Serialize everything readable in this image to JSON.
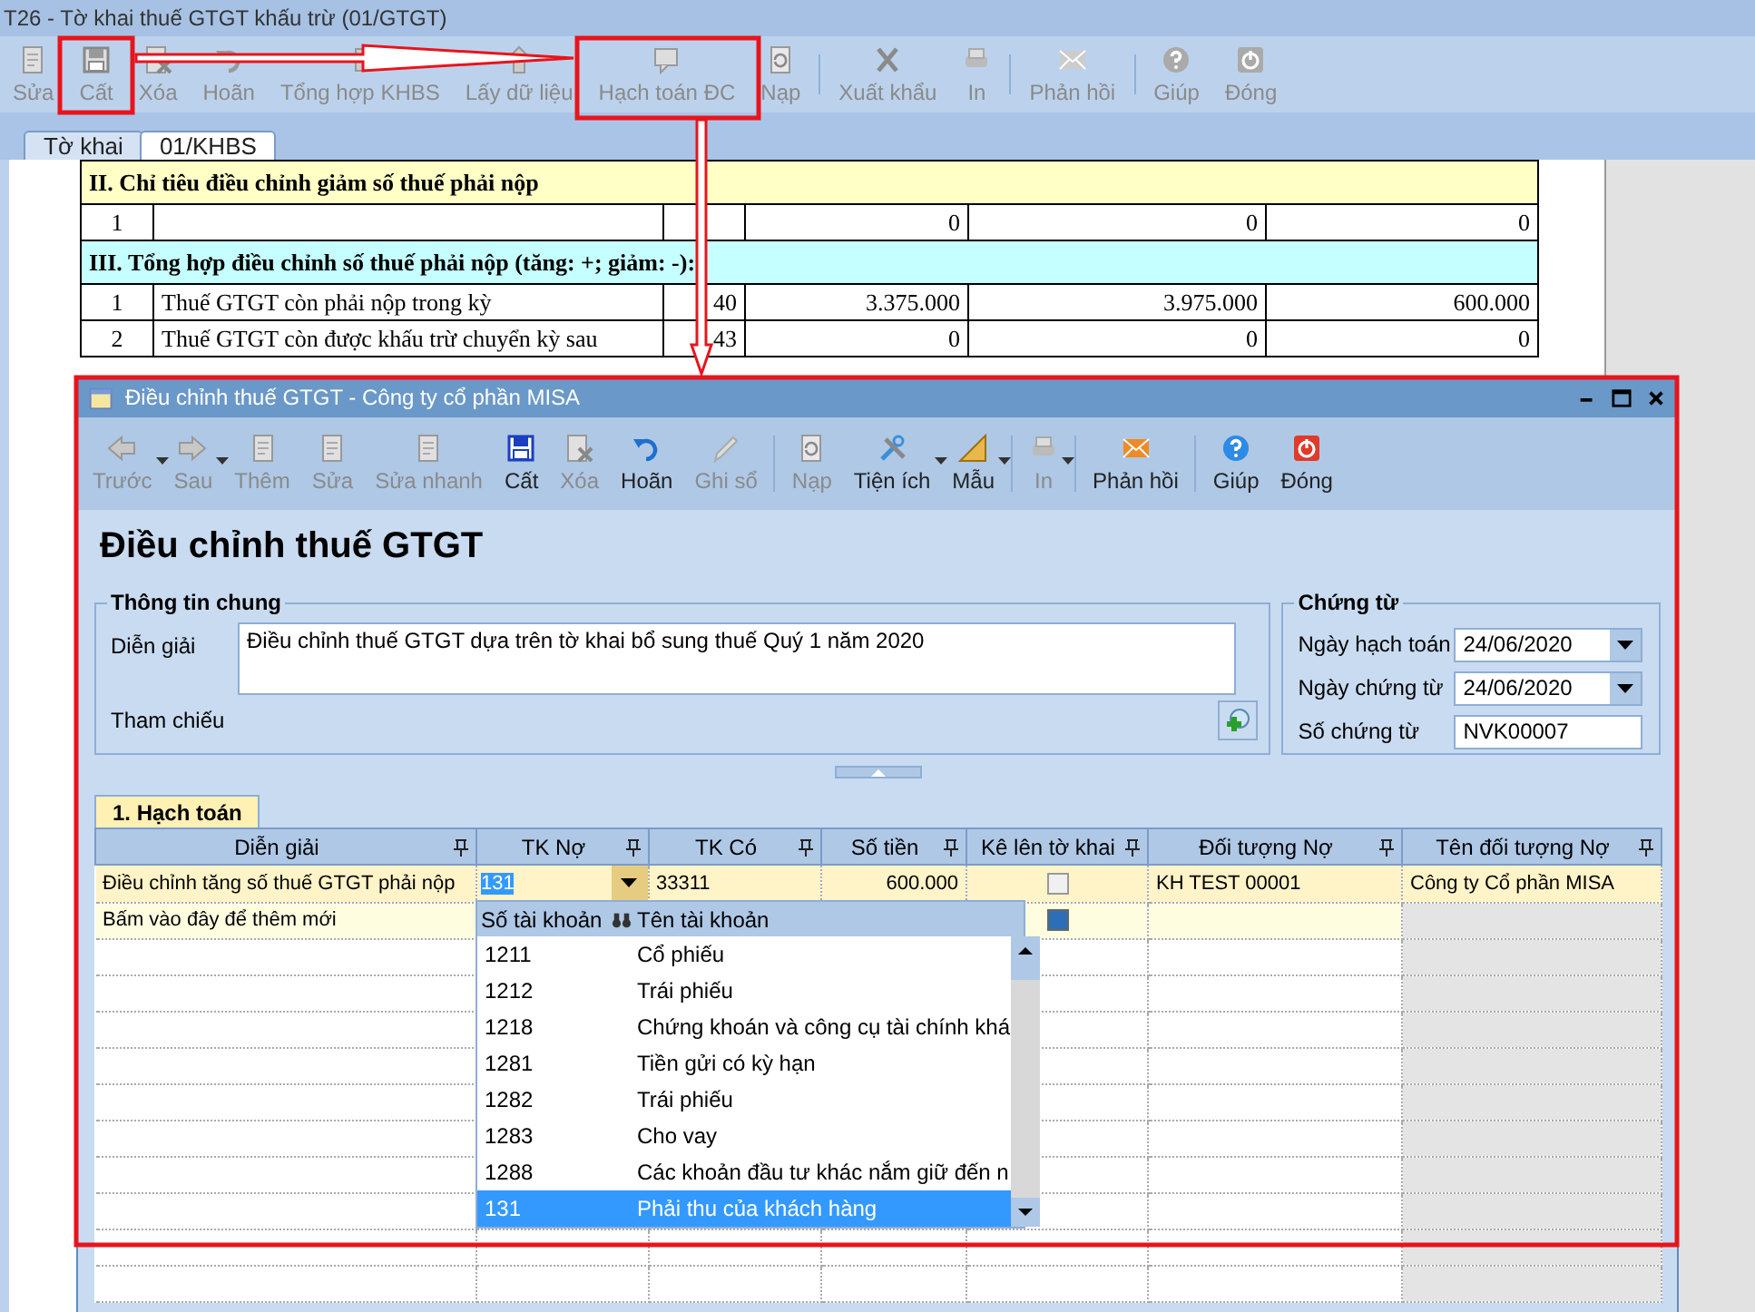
{
  "main_window": {
    "title": "T26 - Tờ khai thuế GTGT khấu trừ (01/GTGT)"
  },
  "toolbar": [
    {
      "kind": "button",
      "label": "Sửa",
      "disabled": true
    },
    {
      "kind": "button",
      "label": "Cất",
      "disabled": true
    },
    {
      "kind": "button",
      "label": "Xóa",
      "disabled": true
    },
    {
      "kind": "button",
      "label": "Hoãn",
      "disabled": true
    },
    {
      "kind": "button",
      "label": "Tổng hợp KHBS",
      "disabled": true
    },
    {
      "kind": "button",
      "label": "Lấy dữ liệu",
      "disabled": true
    },
    {
      "kind": "button",
      "label": "Hạch toán ĐC",
      "disabled": true
    },
    {
      "kind": "button",
      "label": "Nạp",
      "disabled": true
    },
    {
      "kind": "separator"
    },
    {
      "kind": "button",
      "label": "Xuất khẩu",
      "disabled": true
    },
    {
      "kind": "button",
      "label": "In",
      "disabled": true
    },
    {
      "kind": "separator"
    },
    {
      "kind": "button",
      "label": "Phản hồi",
      "disabled": true
    },
    {
      "kind": "separator"
    },
    {
      "kind": "button",
      "label": "Giúp",
      "disabled": true
    },
    {
      "kind": "button",
      "label": "Đóng",
      "disabled": true
    }
  ],
  "tabs": [
    {
      "label": "Tờ khai",
      "selected": false
    },
    {
      "label": "01/KHBS",
      "selected": true
    }
  ],
  "sheet": {
    "rows": [
      {
        "kind": "section",
        "text": "II. Chỉ tiêu điều chỉnh giảm số thuế phải nộp",
        "color": "#ffffc6"
      },
      {
        "kind": "data",
        "cells": [
          "1",
          "",
          "",
          "0",
          "0",
          "0"
        ]
      },
      {
        "kind": "section",
        "text": "III. Tổng hợp điều chỉnh số thuế phải nộp (tăng: +; giảm: -):",
        "color": "#c6ffff"
      },
      {
        "kind": "data",
        "cells": [
          "1",
          "Thuế GTGT còn phải nộp trong kỳ",
          "40",
          "3.375.000",
          "3.975.000",
          "600.000"
        ]
      },
      {
        "kind": "data",
        "cells": [
          "2",
          "Thuế GTGT còn được khấu trừ chuyển kỳ sau",
          "43",
          "0",
          "0",
          "0"
        ]
      }
    ]
  },
  "dialog": {
    "title": "Điều chỉnh thuế GTGT - Công ty cổ phần MISA",
    "toolbar": [
      {
        "kind": "button",
        "label": "Trước",
        "disabled": true,
        "dropdown": true
      },
      {
        "kind": "button",
        "label": "Sau",
        "disabled": true,
        "dropdown": true
      },
      {
        "kind": "button",
        "label": "Thêm",
        "disabled": true,
        "dropdown": false
      },
      {
        "kind": "button",
        "label": "Sửa",
        "disabled": true,
        "dropdown": false
      },
      {
        "kind": "button",
        "label": "Sửa nhanh",
        "disabled": true,
        "dropdown": false
      },
      {
        "kind": "button",
        "label": "Cất",
        "disabled": false,
        "dropdown": false
      },
      {
        "kind": "button",
        "label": "Xóa",
        "disabled": true,
        "dropdown": false
      },
      {
        "kind": "button",
        "label": "Hoãn",
        "disabled": false,
        "dropdown": false
      },
      {
        "kind": "button",
        "label": "Ghi sổ",
        "disabled": true,
        "dropdown": false
      },
      {
        "kind": "separator"
      },
      {
        "kind": "button",
        "label": "Nạp",
        "disabled": true,
        "dropdown": false
      },
      {
        "kind": "button",
        "label": "Tiện ích",
        "disabled": false,
        "dropdown": true
      },
      {
        "kind": "button",
        "label": "Mẫu",
        "disabled": false,
        "dropdown": true
      },
      {
        "kind": "separator"
      },
      {
        "kind": "button",
        "label": "In",
        "disabled": true,
        "dropdown": true
      },
      {
        "kind": "separator"
      },
      {
        "kind": "button",
        "label": "Phản hồi",
        "disabled": false,
        "dropdown": false
      },
      {
        "kind": "separator"
      },
      {
        "kind": "button",
        "label": "Giúp",
        "disabled": false,
        "dropdown": false
      },
      {
        "kind": "button",
        "label": "Đóng",
        "disabled": false,
        "dropdown": false
      }
    ],
    "heading": "Điều chỉnh thuế GTGT",
    "general": {
      "legend": "Thông tin chung",
      "description_label": "Diễn giải",
      "description": "Điều chỉnh thuế GTGT dựa trên tờ khai bổ sung thuế Quý 1 năm 2020",
      "reference_label": "Tham chiếu"
    },
    "voucher": {
      "legend": "Chứng từ",
      "fields": [
        {
          "kind": "date",
          "label": "Ngày hạch toán",
          "value": "24/06/2020"
        },
        {
          "kind": "date",
          "label": "Ngày chứng từ",
          "value": "24/06/2020"
        },
        {
          "kind": "text",
          "label": "Số chứng từ",
          "value": "NVK00007"
        }
      ]
    },
    "detail_tabs": [
      {
        "label": "1. Hạch toán",
        "selected": true
      }
    ],
    "grid": {
      "columns": [
        "Diễn giải",
        "TK Nợ",
        "TK Có",
        "Số tiền",
        "Kê lên tờ khai",
        "Đối tượng Nợ",
        "Tên đối tượng Nợ"
      ],
      "rows": [
        {
          "cells": [
            "Điều chỉnh tăng số thuế GTGT phải nộp",
            "131",
            "33311",
            "600.000",
            "",
            "KH TEST 00001",
            "Công ty Cổ phần MISA"
          ],
          "checked": false
        }
      ],
      "new_row": {
        "hint": "Bấm vào đây để thêm mới",
        "checked": true
      }
    },
    "account_dropdown": {
      "columns": [
        "Số tài khoản",
        "Tên tài khoản"
      ],
      "rows": [
        {
          "number": "1211",
          "name": "Cổ phiếu",
          "selected": false
        },
        {
          "number": "1212",
          "name": "Trái phiếu",
          "selected": false
        },
        {
          "number": "1218",
          "name": "Chứng khoán và công cụ tài chính khá",
          "selected": false
        },
        {
          "number": "1281",
          "name": "Tiền gửi có kỳ hạn",
          "selected": false
        },
        {
          "number": "1282",
          "name": "Trái phiếu",
          "selected": false
        },
        {
          "number": "1283",
          "name": "Cho vay",
          "selected": false
        },
        {
          "number": "1288",
          "name": "Các khoản đầu tư khác nắm giữ đến n",
          "selected": false
        },
        {
          "number": "131",
          "name": "Phải thu của khách hàng",
          "selected": true
        }
      ]
    }
  }
}
